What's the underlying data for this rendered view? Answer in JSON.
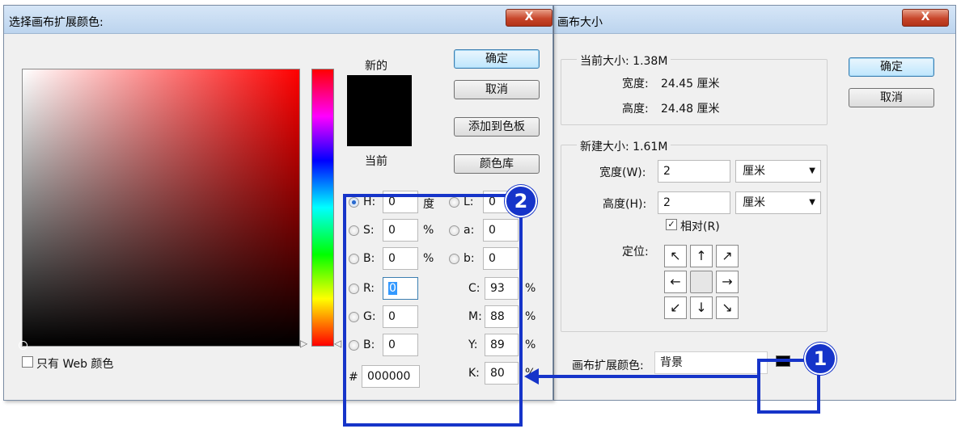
{
  "canvas_size_dialog": {
    "title": "画布大小",
    "close_label": "X",
    "ok_label": "确定",
    "cancel_label": "取消",
    "current_size": {
      "label": "当前大小: 1.38M",
      "width_label": "宽度:",
      "width_value": "24.45 厘米",
      "height_label": "高度:",
      "height_value": "24.48 厘米"
    },
    "new_size": {
      "label": "新建大小: 1.61M",
      "width_label": "宽度(W):",
      "width_value": "2",
      "width_unit": "厘米",
      "height_label": "高度(H):",
      "height_value": "2",
      "height_unit": "厘米",
      "relative_label": "相对(R)",
      "relative_checked": true,
      "anchor_label": "定位:",
      "anchor_arrows": [
        "↖",
        "↑",
        "↗",
        "←",
        "",
        "→",
        "↙",
        "↓",
        "↘"
      ]
    },
    "extension_color": {
      "label": "画布扩展颜色:",
      "value": "背景",
      "swatch_color": "#000000"
    }
  },
  "color_picker_dialog": {
    "title": "选择画布扩展颜色:",
    "close_label": "X",
    "ok_label": "确定",
    "cancel_label": "取消",
    "add_swatch_label": "添加到色板",
    "color_libraries_label": "颜色库",
    "new_label": "新的",
    "current_label": "当前",
    "web_only_label": "只有 Web 颜色",
    "preview_new_color": "#000000",
    "preview_current_color": "#000000",
    "fields": {
      "h": {
        "label": "H:",
        "value": "0",
        "unit": "度"
      },
      "s": {
        "label": "S:",
        "value": "0",
        "unit": "%"
      },
      "bri": {
        "label": "B:",
        "value": "0",
        "unit": "%"
      },
      "r": {
        "label": "R:",
        "value": "0"
      },
      "g": {
        "label": "G:",
        "value": "0"
      },
      "b": {
        "label": "B:",
        "value": "0"
      },
      "lab_l": {
        "label": "L:",
        "value": "0"
      },
      "lab_a": {
        "label": "a:",
        "value": "0"
      },
      "lab_b": {
        "label": "b:",
        "value": "0"
      },
      "c": {
        "label": "C:",
        "value": "93",
        "unit": "%"
      },
      "m": {
        "label": "M:",
        "value": "88",
        "unit": "%"
      },
      "y": {
        "label": "Y:",
        "value": "89",
        "unit": "%"
      },
      "k": {
        "label": "K:",
        "value": "80",
        "unit": "%"
      },
      "hex": {
        "label": "#",
        "value": "000000"
      }
    }
  },
  "annotations": {
    "badge_1": "1",
    "badge_2": "2",
    "color": "#1634c9"
  }
}
